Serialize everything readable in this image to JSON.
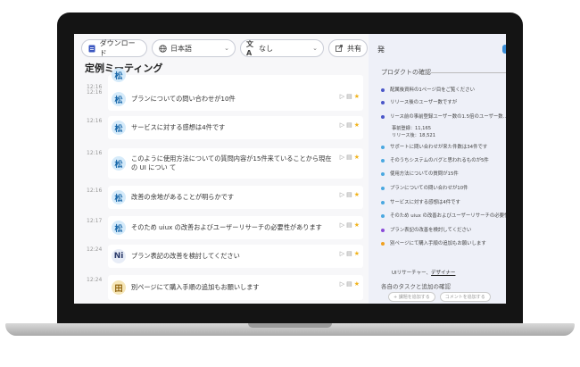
{
  "toolbar": {
    "download_label": "ダウンロード",
    "language_label": "日本語",
    "translation_label": "なし",
    "share_label": "共有"
  },
  "meeting": {
    "title": "定例ミーティング"
  },
  "messages": [
    {
      "time": "12:16",
      "avatar": "松",
      "text": ""
    },
    {
      "time": "12:16",
      "avatar": "松",
      "text": "プランについての問い合わせが10件"
    },
    {
      "time": "12:16",
      "avatar": "松",
      "text": "サービスに対する感想は4件です"
    },
    {
      "time": "12:16",
      "avatar": "松",
      "text": "このように使用方法についての質問内容が15件来ていることから現在の UI につい て"
    },
    {
      "time": "12:16",
      "avatar": "松",
      "text": "改善の余地があることが明らかです"
    },
    {
      "time": "12:17",
      "avatar": "松",
      "text": "そのため uiux の改善およびユーザーリサーチの必要性があります"
    },
    {
      "time": "12:24",
      "avatar": "Ni",
      "text": "プラン表記の改善を検討してください"
    },
    {
      "time": "12:24",
      "avatar": "田",
      "text": "別ページにて購入手順の追加もお願いします"
    }
  ],
  "panel": {
    "header": "発",
    "section_title": "プロダクトの確認",
    "items": [
      {
        "text": "配属後資料の1ページ目をご覧ください",
        "color": "#4a56c8"
      },
      {
        "text": "リリース後のユーザー数ですが",
        "color": "#4a56c8"
      },
      {
        "text": "リース前の事前登録ユーザー数の1.5倍のユーザー数...",
        "color": "#4a56c8"
      },
      {
        "text": "サポートに問い合わせが来た件数は34件です",
        "color": "#4aa8e0"
      },
      {
        "text": "そのうちシステムのバグと思われるものが5件",
        "color": "#4aa8e0"
      },
      {
        "text": "使用方法についての質問が15件",
        "color": "#4aa8e0"
      },
      {
        "text": "プランについての問い合わせが10件",
        "color": "#4aa8e0"
      },
      {
        "text": "サービスに対する感想は4件です",
        "color": "#4aa8e0"
      },
      {
        "text": "そのため uiux の改善およびユーザーリサーチの必要性",
        "color": "#4aa8e0"
      },
      {
        "text": "プラン表記の改善を検討してください",
        "color": "#8a4ad8"
      },
      {
        "text": "別ページにて購入手順の追加もお願いします",
        "color": "#f0a020"
      }
    ],
    "stats": [
      "事前登録：11,165",
      "リリース後：18,521"
    ],
    "research_prefix": "UIリサーチャー、",
    "research_link": "デザイナー",
    "task_title": "各自のタスクと追加の確認",
    "btn_add_task": "+ 課題を追加する",
    "btn_add_comment": "コメントを追加する"
  }
}
